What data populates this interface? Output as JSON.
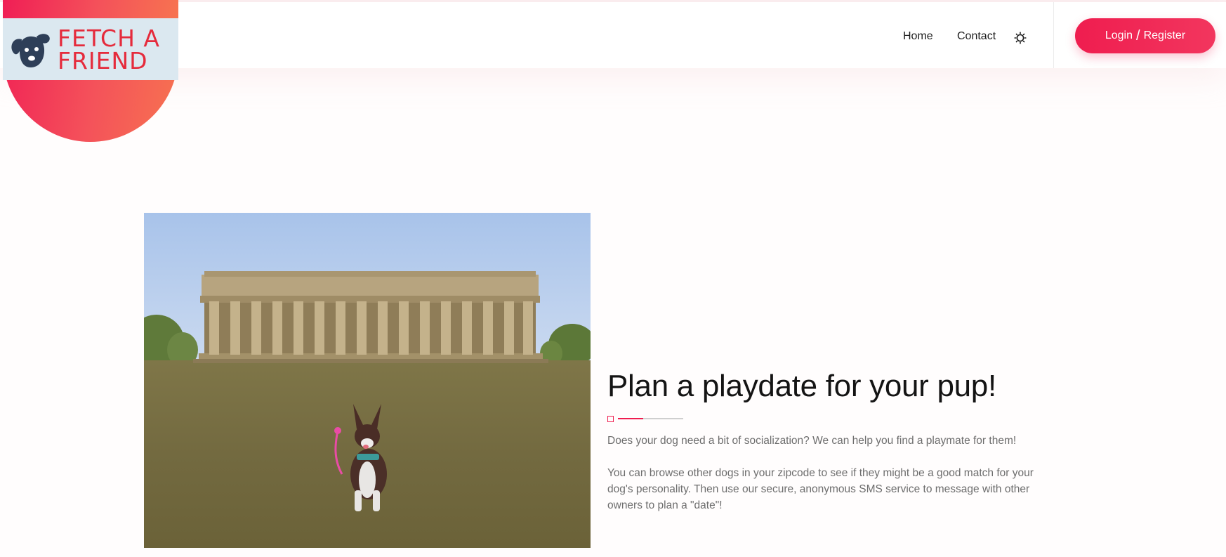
{
  "brand": {
    "line1": "FETCH A",
    "line2": "FRIEND",
    "colors": {
      "primary": "#ef1d4f",
      "logo_bg": "#dbe8f0",
      "logo_text": "#e52b3c",
      "dog": "#2e3f58"
    }
  },
  "nav": {
    "home": "Home",
    "contact": "Contact",
    "theme_icon": "sun-icon"
  },
  "auth": {
    "login": "Login",
    "separator": "/",
    "register": "Register"
  },
  "hero": {
    "title": "Plan a playdate for your pup!",
    "paragraph1": "Does your dog need a bit of socialization? We can help you find a playmate for them!",
    "paragraph2": "You can browse other dogs in your zipcode to see if they might be a good match for your dog's personality. Then use our secure, anonymous SMS service to message with other owners to plan a \"date\"!"
  }
}
